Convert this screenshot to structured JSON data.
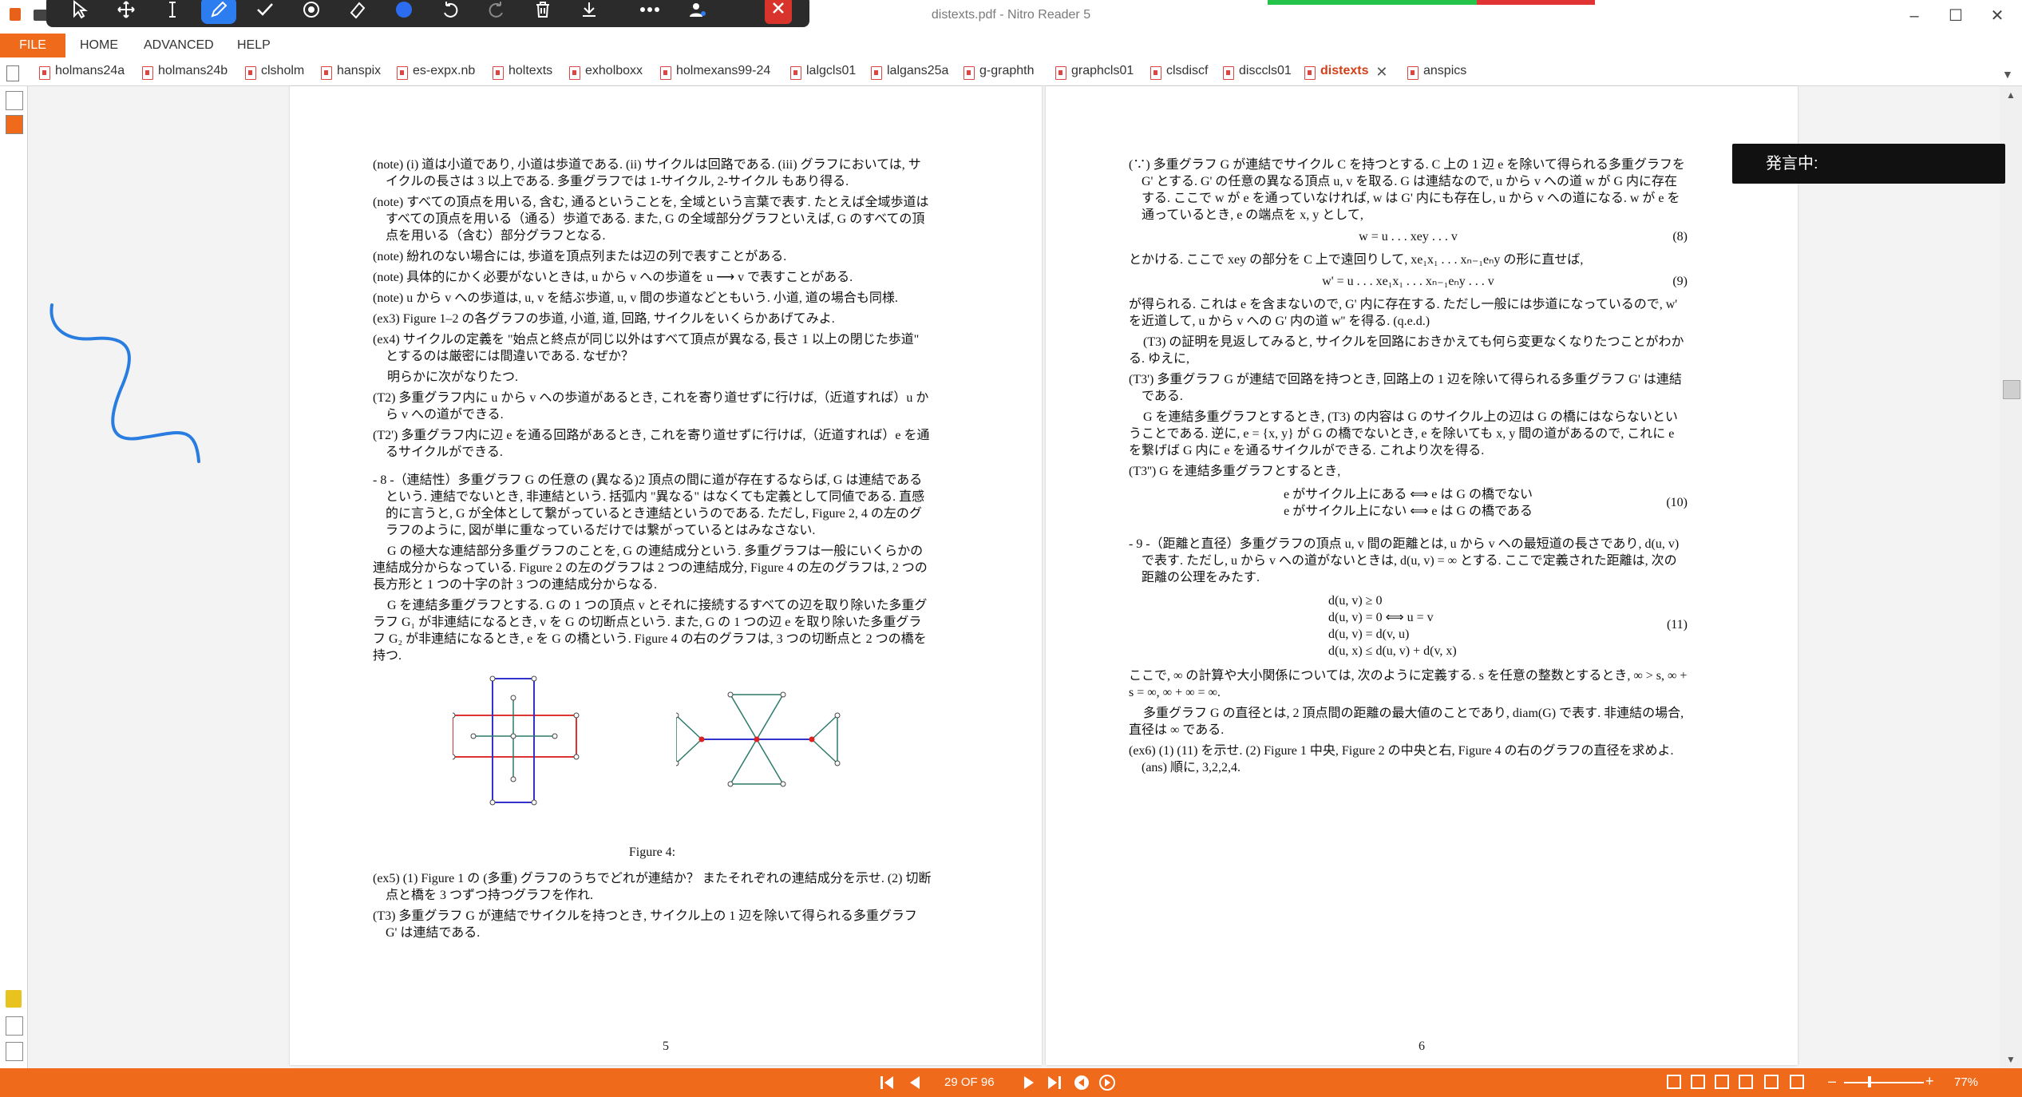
{
  "window": {
    "title": "distexts.pdf - Nitro Reader 5",
    "minimize": "–",
    "maximize": "☐",
    "close": "✕"
  },
  "menu": {
    "file": "FILE",
    "home": "HOME",
    "advanced": "ADVANCED",
    "help": "HELP"
  },
  "tabs": [
    {
      "label": "holmans24a"
    },
    {
      "label": "holmans24b"
    },
    {
      "label": "clsholm"
    },
    {
      "label": "hanspix"
    },
    {
      "label": "es-expx.nb"
    },
    {
      "label": "holtexts"
    },
    {
      "label": "exholboxx"
    },
    {
      "label": "holmexans99-24"
    },
    {
      "label": "lalgcls01"
    },
    {
      "label": "lalgans25a"
    },
    {
      "label": "g-graphth"
    },
    {
      "label": "graphcls01"
    },
    {
      "label": "clsdiscf"
    },
    {
      "label": "disccls01"
    },
    {
      "label": "distexts",
      "active": true
    },
    {
      "label": "anspics"
    }
  ],
  "popup": {
    "text": "発言中:"
  },
  "status": {
    "page_indicator": "29 OF 96",
    "zoom": "77%",
    "zoom_minus": "–",
    "zoom_plus": "+"
  },
  "page5": {
    "number": "5",
    "p1": "(note) (i) 道は小道であり, 小道は歩道である. (ii) サイクルは回路である. (iii) グラフにおいては, サイクルの長さは 3 以上である. 多重グラフでは 1-サイクル, 2-サイクル もあり得る.",
    "p2": "(note) すべての頂点を用いる, 含む, 通るということを, 全域という言葉で表す. たとえば全域歩道はすべての頂点を用いる（通る）歩道である. また, G の全域部分グラフといえば, G のすべての頂点を用いる（含む）部分グラフとなる.",
    "p3": "(note) 紛れのない場合には, 歩道を頂点列または辺の列で表すことがある.",
    "p4": "(note) 具体的にかく必要がないときは, u から v への歩道を u ⟶ v で表すことがある.",
    "p5": "(note) u から v への歩道は, u, v を結ぶ歩道, u, v 間の歩道などともいう. 小道, 道の場合も同様.",
    "p6": "(ex3) Figure 1–2 の各グラフの歩道, 小道, 道, 回路, サイクルをいくらかあげてみよ.",
    "p7": "(ex4) サイクルの定義を \"始点と終点が同じ以外はすべて頂点が異なる, 長さ 1 以上の閉じた歩道\" とするのは厳密には間違いである. なぜか？",
    "p8": "明らかに次がなりたつ.",
    "p9": "(T2) 多重グラフ内に u から v への歩道があるとき, これを寄り道せずに行けば,（近道すれば）u から v への道ができる.",
    "p10": "(T2') 多重グラフ内に辺 e を通る回路があるとき, これを寄り道せずに行けば,（近道すれば）e を通るサイクルができる.",
    "p11": "- 8 -（連結性）多重グラフ G の任意の (異なる)2 頂点の間に道が存在するならば, G は連結であるという. 連結でないとき, 非連結という. 括弧内 \"異なる\" はなくても定義として同値である. 直感的に言うと, G が全体として繋がっているとき連結というのである. ただし, Figure 2, 4 の左のグラフのように, 図が単に重なっているだけでは繋がっているとはみなさない.",
    "p12": "G の極大な連結部分多重グラフのことを, G の連結成分という. 多重グラフは一般にいくらかの連結成分からなっている. Figure 2 の左のグラフは 2 つの連結成分, Figure 4 の左のグラフは, 2 つの長方形と 1 つの十字の計 3 つの連結成分からなる.",
    "p13": "G を連結多重グラフとする. G の 1 つの頂点 v とそれに接続するすべての辺を取り除いた多重グラフ G₁ が非連結になるとき, v を G の切断点という. また, G の 1 つの辺 e を取り除いた多重グラフ G₂ が非連結になるとき, e を G の橋という. Figure 4 の右のグラフは, 3 つの切断点と 2 つの橋を持つ.",
    "caption": "Figure 4:",
    "p14": "(ex5) (1) Figure 1 の (多重) グラフのうちでどれが連結か？ またそれぞれの連結成分を示せ. (2) 切断点と橋を 3 つずつ持つグラフを作れ.",
    "p15": "(T3) 多重グラフ G が連結でサイクルを持つとき, サイクル上の 1 辺を除いて得られる多重グラフ G' は連結である."
  },
  "page6": {
    "number": "6",
    "p1": "(∵) 多重グラフ G が連結でサイクル C を持つとする. C 上の 1 辺 e を除いて得られる多重グラフを G' とする. G' の任意の異なる頂点 u, v を取る. G は連結なので, u から v への道 w が G 内に存在する. ここで w が e を通っていなければ, w は G' 内にも存在し, u から v への道になる. w が e を通っているとき, e の端点を x, y として,",
    "eq8": "w = u . . . xey . . . v",
    "eq8no": "(8)",
    "p2": "とかける. ここで xey の部分を C 上で遠回りして, xe₁x₁ . . . xₙ₋₁eₙy の形に直せば,",
    "eq9": "w' = u . . . xe₁x₁ . . . xₙ₋₁eₙy . . . v",
    "eq9no": "(9)",
    "p3": "が得られる. これは e を含まないので, G' 内に存在する. ただし一般には歩道になっているので, w' を近道して, u から v への G' 内の道 w'' を得る. (q.e.d.)",
    "p4": "(T3) の証明を見返してみると, サイクルを回路におきかえても何ら変更なくなりたつことがわかる. ゆえに,",
    "p5": "(T3') 多重グラフ G が連結で回路を持つとき, 回路上の 1 辺を除いて得られる多重グラフ G' は連結である.",
    "p6": "G を連結多重グラフとするとき, (T3) の内容は G のサイクル上の辺は G の橋にはならないということである. 逆に, e = {x, y} が G の橋でないとき, e を除いても x, y 間の道があるので, これに e を繋げば G 内に e を通るサイクルができる. これより次を得る.",
    "p7": "(T3'') G を連結多重グラフとするとき,",
    "eq10a": "e がサイクル上にある  ⟺  e は G の橋でない",
    "eq10b": "e がサイクル上にない  ⟺  e は G の橋である",
    "eq10no": "(10)",
    "p8": "- 9 -（距離と直径）多重グラフの頂点 u, v 間の距離とは, u から v への最短道の長さであり, d(u, v) で表す. ただし, u から v への道がないときは, d(u, v) = ∞ とする. ここで定義された距離は, 次の距離の公理をみたす.",
    "eq11a": "d(u, v) ≥ 0",
    "eq11b": "d(u, v) = 0  ⟺  u = v",
    "eq11c": "d(u, v) = d(v, u)",
    "eq11d": "d(u, x) ≤ d(u, v) + d(v, x)",
    "eq11no": "(11)",
    "p9": "ここで, ∞ の計算や大小関係については, 次のように定義する. s を任意の整数とするとき, ∞ > s, ∞ + s = ∞, ∞ + ∞ = ∞.",
    "p10": "多重グラフ G の直径とは, 2 頂点間の距離の最大値のことであり, diam(G) で表す. 非連結の場合, 直径は ∞ である.",
    "p11": "(ex6) (1) (11) を示せ. (2) Figure 1 中央, Figure 2 の中央と右, Figure 4 の右のグラフの直径を求めよ. (ans) 順に, 3,2,2,4."
  },
  "colors": {
    "accent": "#ef6a1a",
    "toolbar": "#2b2b2b",
    "toolbar_active": "#2c7df0",
    "ink": "#2a7de0"
  }
}
